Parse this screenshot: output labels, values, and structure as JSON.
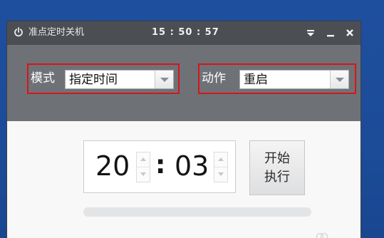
{
  "window": {
    "title": "准点定时关机",
    "clock": "15 : 50 : 57",
    "controls": [
      "menu",
      "minimize",
      "close"
    ]
  },
  "options": {
    "mode": {
      "label": "模式",
      "selected": "指定时间"
    },
    "action": {
      "label": "动作",
      "selected": "重启"
    }
  },
  "timer": {
    "hour": "20",
    "separator": ":",
    "minute": "03"
  },
  "start_button": {
    "label": "开始\n执行"
  },
  "icons": {
    "app": "power-icon",
    "menu": "dropdown-menu-icon",
    "minimize": "minimize-icon",
    "close": "close-icon",
    "select_arrow": "chevron-down-icon",
    "spin_up": "spin-up-icon",
    "spin_down": "spin-down-icon"
  },
  "colors": {
    "titlebar": "#4b4f53",
    "options_panel": "#6e7276",
    "highlight_border": "#d8141c",
    "desktop": "#1c4fa0"
  }
}
